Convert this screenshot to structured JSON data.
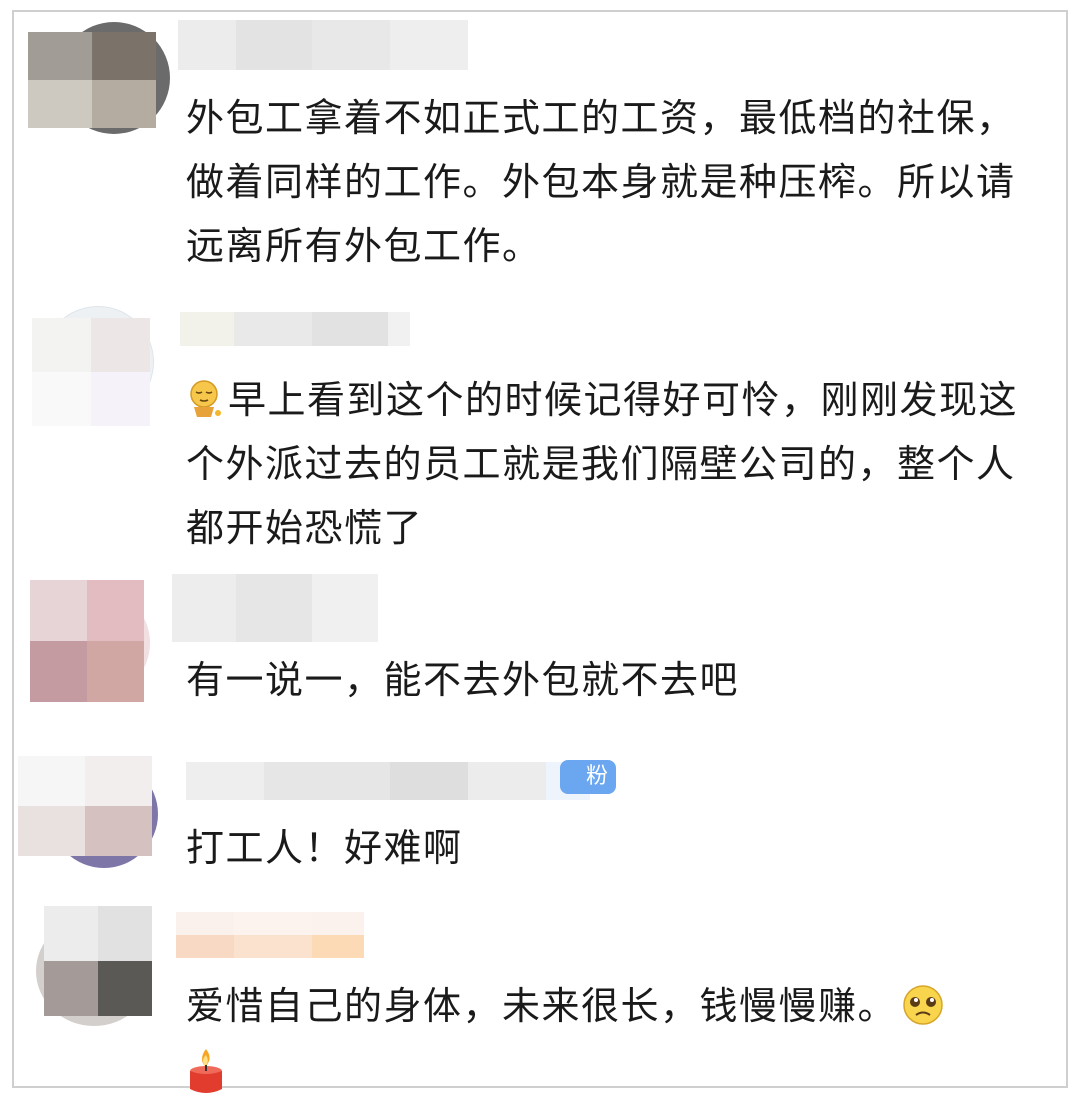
{
  "comments": [
    {
      "text": "外包工拿着不如正式工的工资，最低档的社保，做着同样的工作。外包本身就是种压榨。所以请远离所有外包工作。"
    },
    {
      "emoji": "sleepy-face-emoji",
      "text": "早上看到这个的时候记得好可怜，刚刚发现这个外派过去的员工就是我们隔壁公司的，整个人都开始恐慌了"
    },
    {
      "text": "有一说一，能不去外包就不去吧"
    },
    {
      "badge": "粉",
      "text": "打工人！好难啊"
    },
    {
      "text": "爱惜自己的身体，未来很长，钱慢慢赚。",
      "emoji_end": "pleading-face-emoji",
      "emoji_next": "candle-emoji"
    }
  ],
  "colors": {
    "text": "#1a1a1a",
    "badge": "#6aa7f0",
    "frame_border": "#cfcfcf"
  }
}
